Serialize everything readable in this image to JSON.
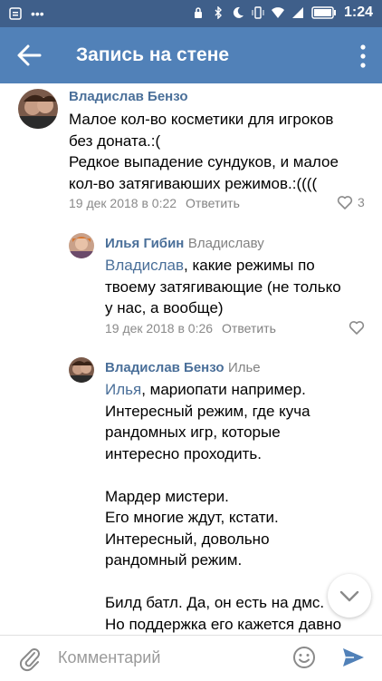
{
  "status_bar": {
    "time": "1:24"
  },
  "header": {
    "title": "Запись на стене"
  },
  "comments": [
    {
      "author": "Владислав Бензо",
      "reply_to": "",
      "mention": "",
      "text": "Малое кол-во косметики для игроков\nбез доната.:(\nРедкое выпадение сундуков, и малое\nкол-во затягиваюших режимов.:((((",
      "date": "19 дек 2018 в 0:22",
      "reply_label": "Ответить",
      "likes": "3"
    },
    {
      "author": "Илья Гибин",
      "reply_to": "Владиславу",
      "mention": "Владислав",
      "text": ", какие режимы по\nтвоему затягивающие (не только\nу нас, а вообще)",
      "date": "19 дек 2018 в 0:26",
      "reply_label": "Ответить",
      "likes": ""
    },
    {
      "author": "Владислав Бензо",
      "reply_to": "Илье",
      "mention": "Илья",
      "text": ", мариопати например.\nИнтересный режим, где куча\nрандомных игр, которые\nинтересно проходить.\n\nМардер мистери.\nЕго многие ждут, кстати.\nИнтересный, довольно\nрандомный режим.\n\nБилд батл. Да, он есть на дмс.\nНо поддержка его кажется давно",
      "date": "",
      "reply_label": "",
      "likes": ""
    }
  ],
  "composer": {
    "placeholder": "Комментарий"
  },
  "colors": {
    "app_bar": "#5181b8",
    "status_bar": "#3f5f8a",
    "link": "#4a6f99"
  }
}
